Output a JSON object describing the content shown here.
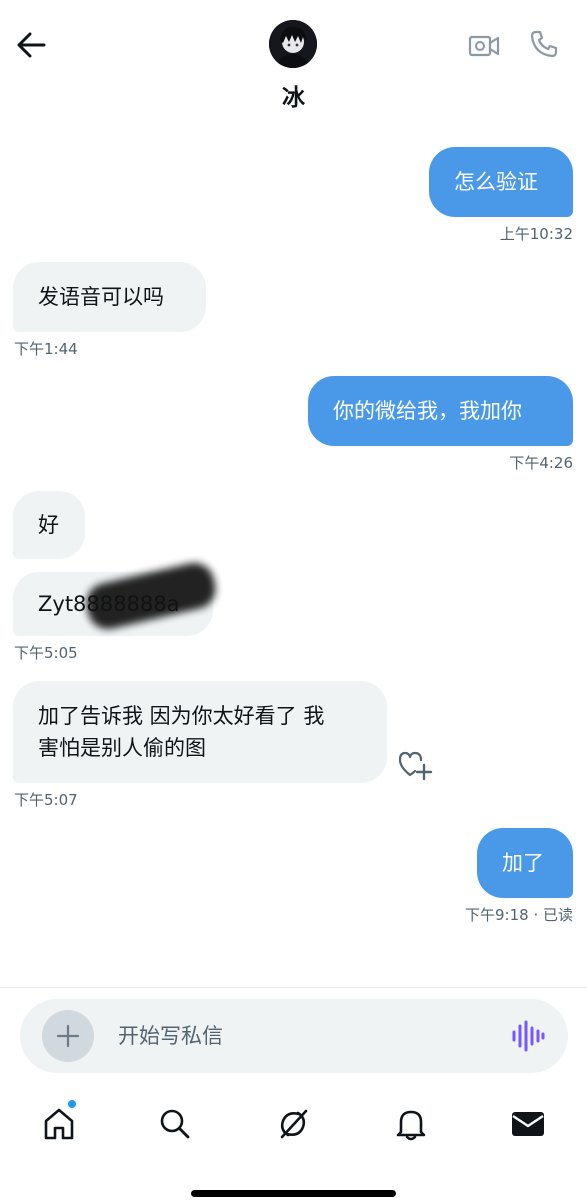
{
  "header": {
    "contact_name": "冰",
    "back_icon": "arrow-left-icon",
    "video_icon": "video-camera-icon",
    "phone_icon": "phone-icon"
  },
  "messages": [
    {
      "direction": "sent",
      "text": "怎么验证",
      "time": "上午10:32"
    },
    {
      "direction": "received",
      "text": "发语音可以吗",
      "time": "下午1:44"
    },
    {
      "direction": "sent",
      "text": "你的微给我，我加你",
      "time": "下午4:26"
    },
    {
      "direction": "received",
      "text": "好"
    },
    {
      "direction": "received",
      "text": "Zyt8888888a",
      "time": "下午5:05",
      "partially_redacted": true
    },
    {
      "direction": "received",
      "lines": [
        "加了告诉我 因为你太好看了 我",
        "害怕是别人偷的图"
      ],
      "time": "下午5:07"
    },
    {
      "direction": "sent",
      "text": "加了",
      "time": "下午9:18 · 已读"
    }
  ],
  "composer": {
    "placeholder": "开始写私信",
    "add_icon": "plus-icon",
    "voice_icon": "voice-wave-icon"
  },
  "tabs": [
    {
      "name": "home",
      "icon": "home-icon",
      "has_badge": true
    },
    {
      "name": "search",
      "icon": "search-icon"
    },
    {
      "name": "grok",
      "icon": "grok-icon"
    },
    {
      "name": "notifications",
      "icon": "bell-icon"
    },
    {
      "name": "messages",
      "icon": "envelope-icon",
      "active": true
    }
  ],
  "colors": {
    "sent_bubble": "#4a99e9",
    "received_bubble": "#eff3f4",
    "timestamp": "#536471",
    "accent": "#1d9bf0",
    "voice": "#7856ff"
  }
}
